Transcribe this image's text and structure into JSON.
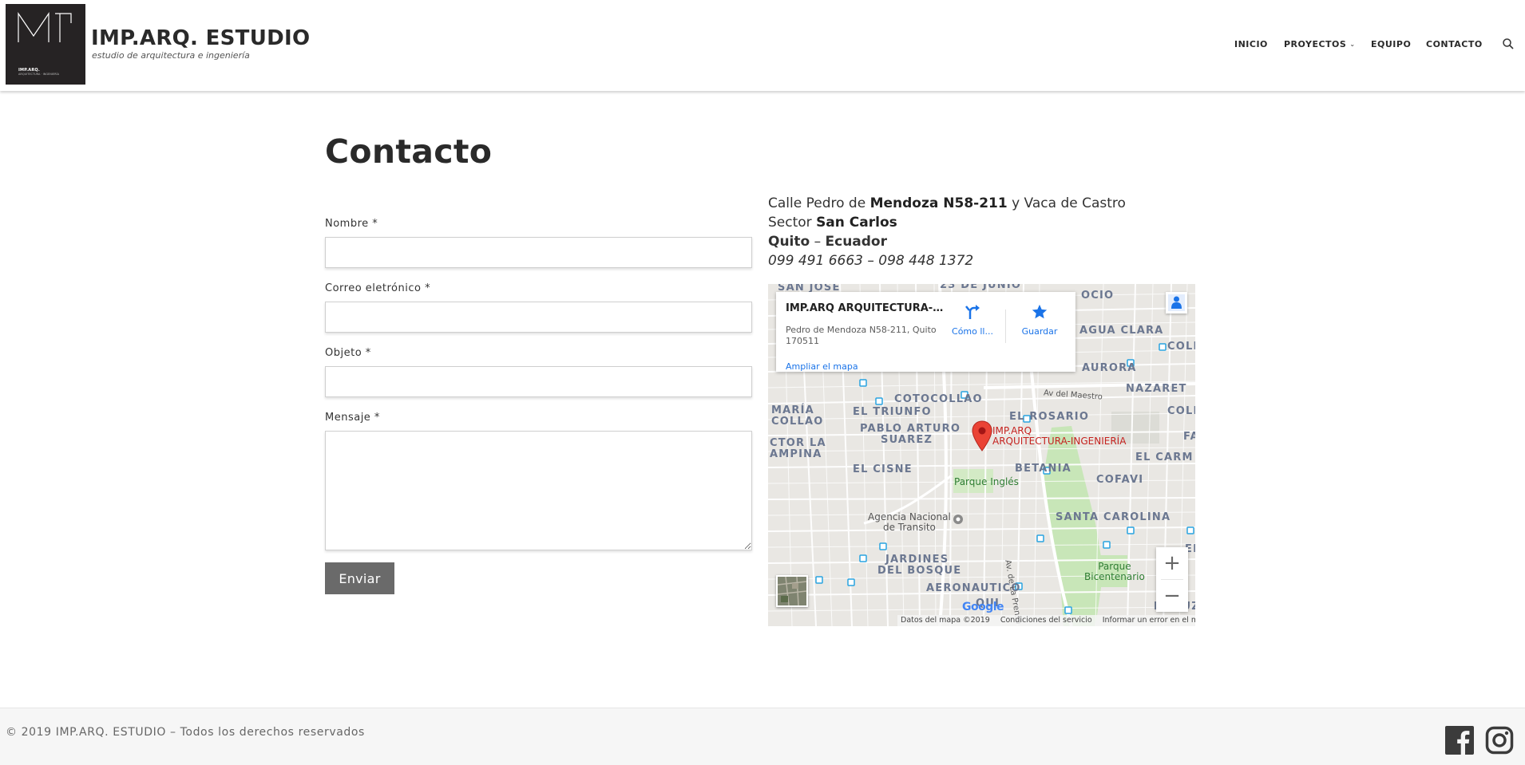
{
  "brand": {
    "logo_small": "IMP.ARQ.",
    "logo_tiny": "ARQUITECTURA · INGENIERÍA",
    "title": "IMP.ARQ. ESTUDIO",
    "subtitle": "estudio de arquitectura e ingeniería"
  },
  "nav": {
    "items": [
      {
        "label": "INICIO"
      },
      {
        "label": "PROYECTOS"
      },
      {
        "label": "EQUIPO"
      },
      {
        "label": "CONTACTO"
      }
    ],
    "dropdown_glyph": "⌄",
    "search_icon": "search-icon"
  },
  "page": {
    "title": "Contacto"
  },
  "form": {
    "nombre_label": "Nombre *",
    "correo_label": "Correo eletrónico *",
    "objeto_label": "Objeto *",
    "mensaje_label": "Mensaje *",
    "nombre_value": "",
    "correo_value": "",
    "objeto_value": "",
    "mensaje_value": "",
    "submit_label": "Enviar"
  },
  "address": {
    "line1_prefix": "Calle Pedro de ",
    "line1_bold": "Mendoza N58-211",
    "line1_suffix": " y Vaca de Castro",
    "line2_prefix": "Sector ",
    "line2_bold": "San Carlos",
    "line3_city": "Quito",
    "line3_sep": " – ",
    "line3_country": "Ecuador",
    "phones": "099 491 6663 – 098 448 1372"
  },
  "map": {
    "card": {
      "title": "IMP.ARQ ARQUITECTURA-INGENIERÍA",
      "address": "Pedro de Mendoza N58-211, Quito 170511",
      "directions_label": "Cómo ll...",
      "save_label": "Guardar",
      "expand_link": "Ampliar el mapa"
    },
    "marker_label_1": "IMP.ARQ",
    "marker_label_2": "ARQUITECTURA-INGENIERÍA",
    "districts": {
      "san_jose": "SAN JOSE",
      "veintitres": "23 DE JUNIO",
      "ocio": "OCIO",
      "agua_clara": "AGUA CLARA",
      "colla": "COLLA",
      "aurora": "AURORA",
      "nazaret": "NAZARET",
      "cotocollao": "COTOCOLLAO",
      "maria_collao_1": "MARÍA",
      "maria_collao_2": "COLLAO",
      "el_triunfo": "EL TRIUNFO",
      "el_rosario": "EL ROSARIO",
      "colla2": "COLLA",
      "pablo_arturo_1": "PABLO ARTURO",
      "pablo_arturo_2": "SUAREZ",
      "sector_la_1": "CTOR LA",
      "sector_la_2": "AMPINA",
      "el_carm": "EL CARM",
      "fa": "FA",
      "el_cisne": "EL CISNE",
      "betania": "BETANIA",
      "cofavi": "COFAVI",
      "santa_carolina": "SANTA CAROLINA",
      "jardines_1": "JARDINES",
      "jardines_2": "DEL BOSQUE",
      "aeronautico": "AERONAUTICO",
      "qui": "QUI",
      "la_luz": "LA LUZ",
      "el": "EL"
    },
    "streets": {
      "av_maestro": "Av del Maestro",
      "av_prensa": "Av. de La Prensa"
    },
    "parks": {
      "parque_ingles": "Parque Inglés",
      "bicentenario_1": "Parque",
      "bicentenario_2": "Bicentenario"
    },
    "poi": {
      "agencia_1": "Agencia Nacional",
      "agencia_2": "de Transito"
    },
    "zoom_in": "+",
    "zoom_out": "−",
    "google": "Google",
    "footer_data": "Datos del mapa ©2019",
    "footer_terms": "Condiciones del servicio",
    "footer_report": "Informar un error en el mapa",
    "colors": {
      "land": "#e9e7e3",
      "road": "#ffffff",
      "park": "#c8e6b8",
      "marker": "#ea4335",
      "link": "#1a73e8"
    }
  },
  "footer": {
    "copyright": "© 2019 IMP.ARQ. ESTUDIO – Todos los derechos reservados",
    "facebook_icon": "facebook-icon",
    "instagram_icon": "instagram-icon"
  }
}
